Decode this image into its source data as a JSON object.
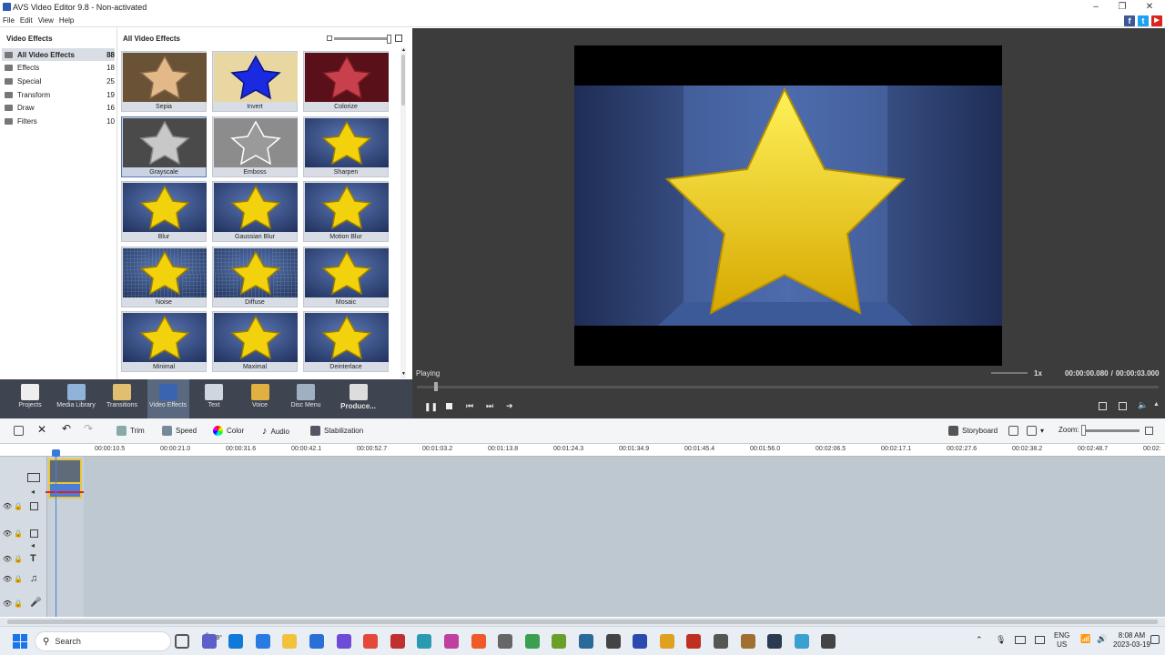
{
  "app": {
    "title": "AVS Video Editor 9.8 - Non-activated",
    "window_controls": [
      "–",
      "❐",
      "✕"
    ]
  },
  "menu": [
    "File",
    "Edit",
    "View",
    "Help"
  ],
  "social": [
    {
      "icon": "facebook-icon",
      "glyph": "f",
      "color": "#3b5998"
    },
    {
      "icon": "twitter-icon",
      "glyph": "t",
      "color": "#1da1f2"
    },
    {
      "icon": "youtube-icon",
      "glyph": "▶",
      "color": "#d9251d"
    }
  ],
  "left_panel": {
    "header": "Video Effects",
    "categories": [
      {
        "label": "All Video Effects",
        "count": "88",
        "selected": true
      },
      {
        "label": "Effects",
        "count": "18"
      },
      {
        "label": "Special",
        "count": "25"
      },
      {
        "label": "Transform",
        "count": "19"
      },
      {
        "label": "Draw",
        "count": "16"
      },
      {
        "label": "Filters",
        "count": "10"
      }
    ]
  },
  "grid": {
    "header": "All Video Effects",
    "effects": [
      {
        "label": "Sepia",
        "style": "sepia"
      },
      {
        "label": "Invert",
        "style": "invert"
      },
      {
        "label": "Colorize",
        "style": "colorize"
      },
      {
        "label": "Grayscale",
        "style": "gray",
        "selected": true
      },
      {
        "label": "Emboss",
        "style": "emboss"
      },
      {
        "label": "Sharpen",
        "style": "normal"
      },
      {
        "label": "Blur",
        "style": "normal"
      },
      {
        "label": "Gaussian Blur",
        "style": "normal"
      },
      {
        "label": "Motion Blur",
        "style": "normal"
      },
      {
        "label": "Noise",
        "style": "noise"
      },
      {
        "label": "Diffuse",
        "style": "noise"
      },
      {
        "label": "Mosaic",
        "style": "normal"
      },
      {
        "label": "Minimal",
        "style": "normal"
      },
      {
        "label": "Maximal",
        "style": "normal"
      },
      {
        "label": "Deinterlace",
        "style": "normal"
      }
    ]
  },
  "player": {
    "status": "Playing",
    "speed": "1x",
    "current_time": "00:00:00.080",
    "total_time": "00:00:03.000",
    "time_separator": "/"
  },
  "toolbar": [
    {
      "label": "Projects",
      "icon": "projects-icon"
    },
    {
      "label": "Media Library",
      "icon": "media-library-icon"
    },
    {
      "label": "Transitions",
      "icon": "transitions-icon"
    },
    {
      "label": "Video Effects",
      "icon": "video-effects-icon",
      "selected": true
    },
    {
      "label": "Text",
      "icon": "text-icon"
    },
    {
      "label": "Voice",
      "icon": "voice-icon"
    },
    {
      "label": "Disc Menu",
      "icon": "disc-menu-icon"
    },
    {
      "label": "Produce...",
      "icon": "produce-icon"
    }
  ],
  "timeline_tools": {
    "trim": "Trim",
    "speed": "Speed",
    "color": "Color",
    "audio": "Audio",
    "stabilization": "Stabilization",
    "storyboard": "Storyboard",
    "zoom": "Zoom:"
  },
  "ruler": [
    "00:00:10.5",
    "00:00:21.0",
    "00:00:31.6",
    "00:00:42.1",
    "00:00:52.7",
    "00:01:03.2",
    "00:01:13.8",
    "00:01:24.3",
    "00:01:34.9",
    "00:01:45.4",
    "00:01:56.0",
    "00:02:06.5",
    "00:02:17.1",
    "00:02:27.6",
    "00:02:38.2",
    "00:02:48.7",
    "00:02:"
  ],
  "taskbar": {
    "search": "Search",
    "weather": "19°",
    "lang": "ENG",
    "region": "US",
    "time": "8:08 AM",
    "date": "2023-03-19"
  }
}
